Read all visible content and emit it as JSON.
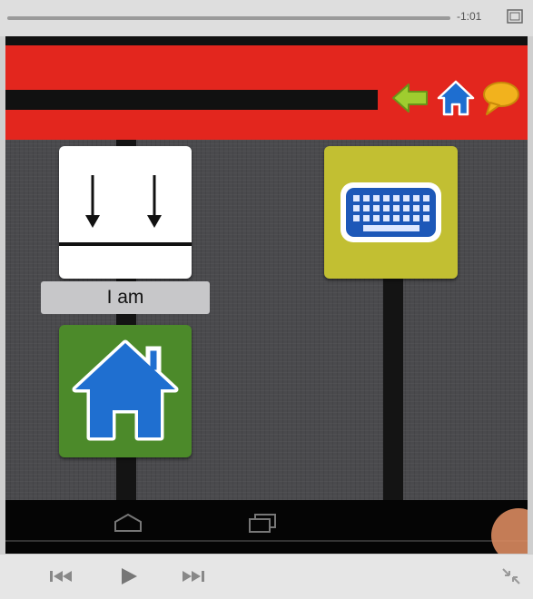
{
  "player": {
    "elapsed_time": "-1:01",
    "icons": [
      "fullscreen-icon",
      "skip-back-icon",
      "play-icon",
      "skip-forward-icon",
      "exit-fullscreen-icon"
    ]
  },
  "app": {
    "header_color": "#e3261e",
    "header_icons": [
      "back-arrow-icon",
      "home-icon",
      "speech-bubble-icon"
    ],
    "tiles": [
      {
        "name": "tile-i-am-arrows",
        "label": "I am",
        "icon": "down-arrows-icon",
        "background": "#ffffff"
      },
      {
        "name": "tile-keyboard",
        "label": "",
        "icon": "keyboard-icon",
        "background": "#c2bf32"
      },
      {
        "name": "tile-home",
        "label": "",
        "icon": "home-icon",
        "background": "#4c8a2a"
      }
    ],
    "android_nav": [
      "home-nav-icon",
      "recent-apps-icon"
    ]
  }
}
